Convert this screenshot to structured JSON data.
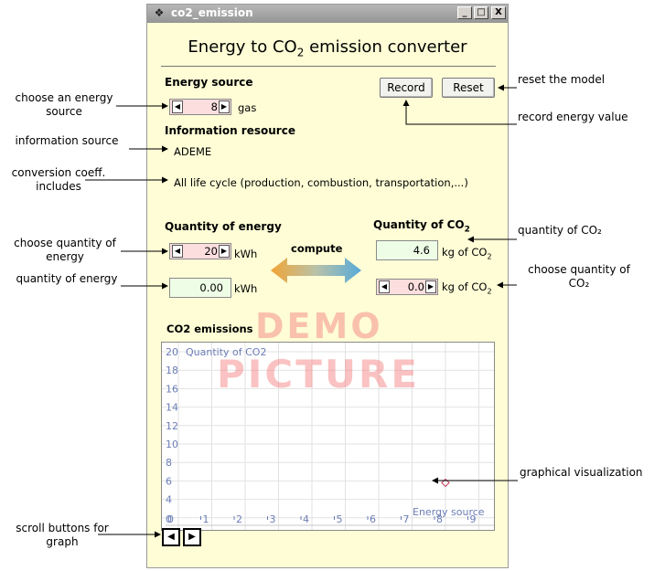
{
  "window": {
    "title": "co2_emission",
    "main_title_pre": "Energy to CO",
    "main_title_sub": "2",
    "main_title_post": " emission converter",
    "buttons": {
      "minimize": "_",
      "maximize": "□",
      "close": "X"
    }
  },
  "energy_source": {
    "label": "Energy source",
    "value": "8",
    "unit": "gas"
  },
  "info_resource": {
    "label": "Information resource",
    "value": "ADEME"
  },
  "lifecycle_text": "All life cycle (production, combustion, transportation,...)",
  "actions": {
    "record": "Record",
    "reset": "Reset"
  },
  "quantity_energy": {
    "label": "Quantity of energy",
    "stepper_value": "20",
    "unit": "kWh",
    "computed_value": "0.00",
    "computed_unit": "kWh"
  },
  "quantity_co2": {
    "label_pre": "Quantity of CO",
    "label_sub": "2",
    "value": "4.6",
    "unit_pre": "kg of CO",
    "unit_sub": "2",
    "stepper_value": "0.0"
  },
  "compute_label": "compute",
  "graph": {
    "title": "CO2 emissions",
    "y_label": "Quantity of CO2",
    "x_label": "Energy source",
    "y_ticks": [
      "20",
      "18",
      "16",
      "14",
      "12",
      "10",
      "8",
      "6",
      "4"
    ],
    "x_ticks": [
      "0",
      "1",
      "2",
      "3",
      "4",
      "5",
      "6",
      "7",
      "8",
      "9"
    ],
    "x_ticks_zero_overlap": "0",
    "points": [
      {
        "x": 8,
        "y": 5.8
      }
    ]
  },
  "watermark": {
    "line1": "DEMO",
    "line2": "PICTURE"
  },
  "annotations": {
    "choose_energy_source": "choose an energy source",
    "information_source": "information source",
    "conversion_coeff": "conversion coeff. includes",
    "choose_quantity_energy": "choose quantity of energy",
    "quantity_energy": "quantity of energy",
    "scroll_buttons": "scroll buttons for graph",
    "reset_model": "reset the model",
    "record_energy_value": "record energy value",
    "quantity_co2": "quantity of CO₂",
    "choose_quantity_co2": "choose quantity of CO₂",
    "graphical_visualization": "graphical visualization"
  }
}
